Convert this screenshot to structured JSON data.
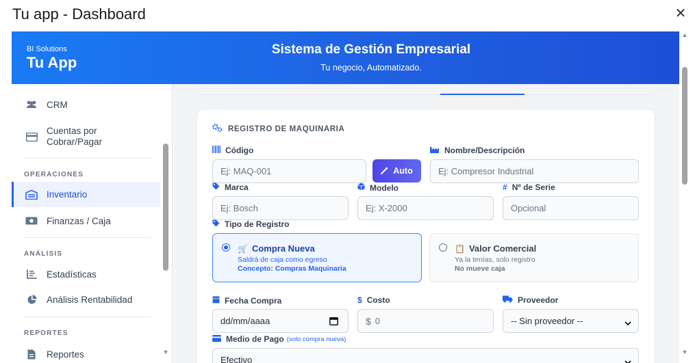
{
  "window": {
    "title": "Tu app - Dashboard",
    "close_glyph": "✕"
  },
  "brand": {
    "sub": "BI Solutions",
    "name": "Tu App"
  },
  "header": {
    "title": "Sistema de Gestión Empresarial",
    "subtitle": "Tu negocio, Automatizado."
  },
  "sidebar": {
    "items_top": [
      {
        "label": "CRM",
        "icon": "users-icon"
      },
      {
        "label": "Cuentas por Cobrar/Pagar",
        "icon": "credit-card-icon"
      }
    ],
    "sections": {
      "operaciones": "OPERACIONES",
      "analisis": "ANÁLISIS",
      "reportes": "REPORTES"
    },
    "operaciones_items": [
      {
        "label": "Inventario",
        "icon": "warehouse-icon",
        "active": true
      },
      {
        "label": "Finanzas / Caja",
        "icon": "money-icon"
      }
    ],
    "analisis_items": [
      {
        "label": "Estadísticas",
        "icon": "chart-line-icon"
      },
      {
        "label": "Análisis Rentabilidad",
        "icon": "pie-chart-icon"
      }
    ],
    "reportes_items": [
      {
        "label": "Reportes",
        "icon": "file-icon"
      }
    ]
  },
  "form": {
    "section_title": "REGISTRO DE MAQUINARIA",
    "codigo": {
      "label": "Código",
      "placeholder": "Ej: MAQ-001"
    },
    "auto_button": "Auto",
    "nombre": {
      "label": "Nombre/Descripción",
      "placeholder": "Ej: Compresor Industrial"
    },
    "marca": {
      "label": "Marca",
      "placeholder": "Ej: Bosch"
    },
    "modelo": {
      "label": "Modelo",
      "placeholder": "Ej: X-2000"
    },
    "serie": {
      "label": "Nº de Serie",
      "placeholder": "Opcional"
    },
    "tipo_registro": {
      "label": "Tipo de Registro",
      "options": [
        {
          "title": "Compra Nueva",
          "line1": "Saldrá de caja como egreso",
          "line2": "Concepto: Compras Maquinaria",
          "selected": true
        },
        {
          "title": "Valor Comercial",
          "line1": "Ya la tenías, solo registro",
          "line2": "No mueve caja",
          "selected": false
        }
      ]
    },
    "fecha": {
      "label": "Fecha Compra",
      "value": "dd/mm/aaaa"
    },
    "costo": {
      "label": "Costo",
      "currency": "$",
      "placeholder": "0"
    },
    "proveedor": {
      "label": "Proveedor",
      "value": "-- Sin proveedor --"
    },
    "medio_pago": {
      "label": "Medio de Pago",
      "hint": "(solo compra nueva)",
      "value": "Efectivo"
    }
  },
  "colors": {
    "accent": "#2563eb",
    "banner_start": "#1a7af5",
    "banner_end": "#1d4fd8",
    "auto_button": "#4f46e5"
  }
}
